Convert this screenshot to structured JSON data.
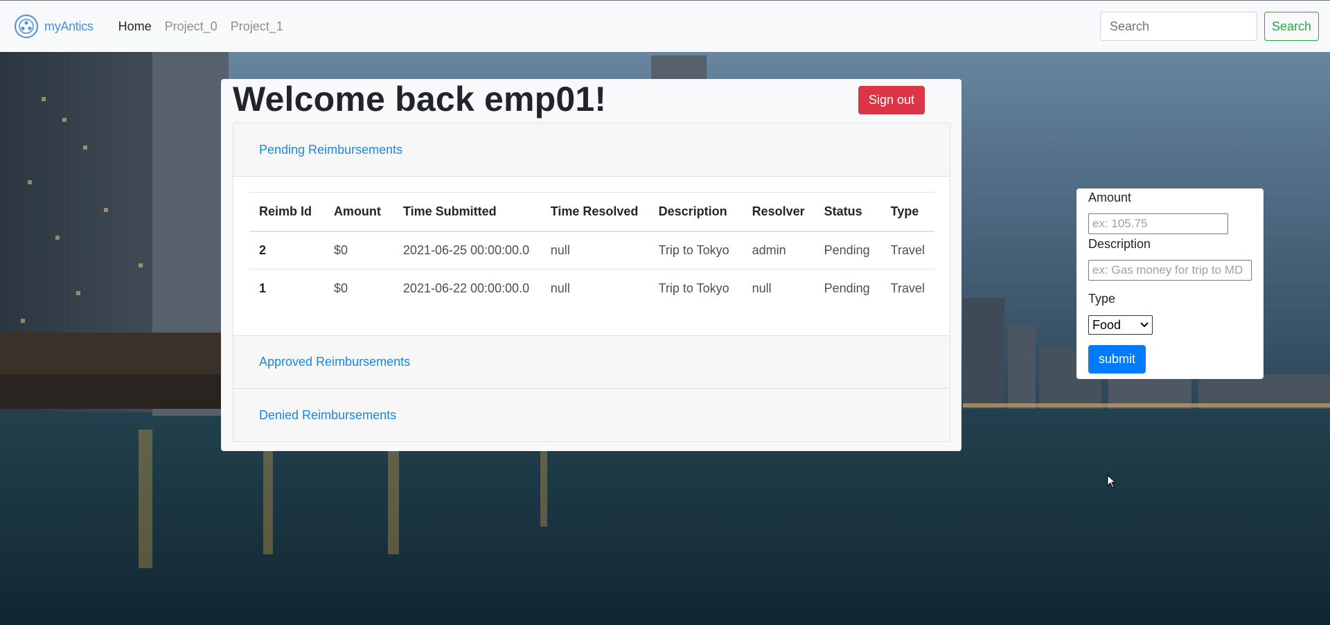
{
  "navbar": {
    "brand_name": "myAntics",
    "links": [
      {
        "label": "Home",
        "active": true
      },
      {
        "label": "Project_0",
        "active": false
      },
      {
        "label": "Project_1",
        "active": false
      }
    ],
    "search_placeholder": "Search",
    "search_button": "Search"
  },
  "main": {
    "welcome": "Welcome back emp01!",
    "signout_label": "Sign out",
    "sections": {
      "pending": "Pending Reimbursements",
      "approved": "Approved Reimbursements",
      "denied": "Denied Reimbursements"
    },
    "table": {
      "headers": [
        "Reimb Id",
        "Amount",
        "Time Submitted",
        "Time Resolved",
        "Description",
        "Resolver",
        "Status",
        "Type"
      ],
      "rows": [
        [
          "2",
          "$0",
          "2021-06-25 00:00:00.0",
          "null",
          "Trip to Tokyo",
          "admin",
          "Pending",
          "Travel"
        ],
        [
          "1",
          "$0",
          "2021-06-22 00:00:00.0",
          "null",
          "Trip to Tokyo",
          "null",
          "Pending",
          "Travel"
        ]
      ]
    }
  },
  "form": {
    "amount_label": "Amount",
    "amount_placeholder": "ex: 105.75",
    "description_label": "Description",
    "description_placeholder": "ex: Gas money for trip to MD",
    "type_label": "Type",
    "type_selected": "Food",
    "submit_label": "submit"
  },
  "colors": {
    "signout": "#dc3545",
    "submit": "#007bff",
    "search_button": "#28a745",
    "link": "#1b87e0"
  }
}
